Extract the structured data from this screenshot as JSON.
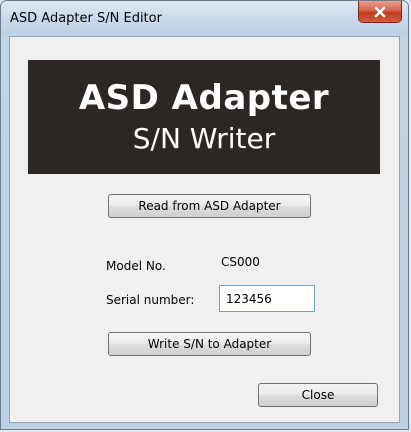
{
  "window": {
    "title": "ASD Adapter S/N Editor",
    "close_glyph": "x"
  },
  "banner": {
    "line1": "ASD Adapter",
    "line2": "S/N Writer",
    "background": "#2c2724",
    "text_color": "#ffffff"
  },
  "actions": {
    "read_label": "Read from ASD Adapter",
    "write_label": "Write S/N to Adapter",
    "close_label": "Close"
  },
  "fields": {
    "model_label": "Model No.",
    "model_value": "CS000",
    "serial_label": "Serial number:",
    "serial_value": "123456"
  },
  "icons": {
    "close": "close-icon"
  }
}
